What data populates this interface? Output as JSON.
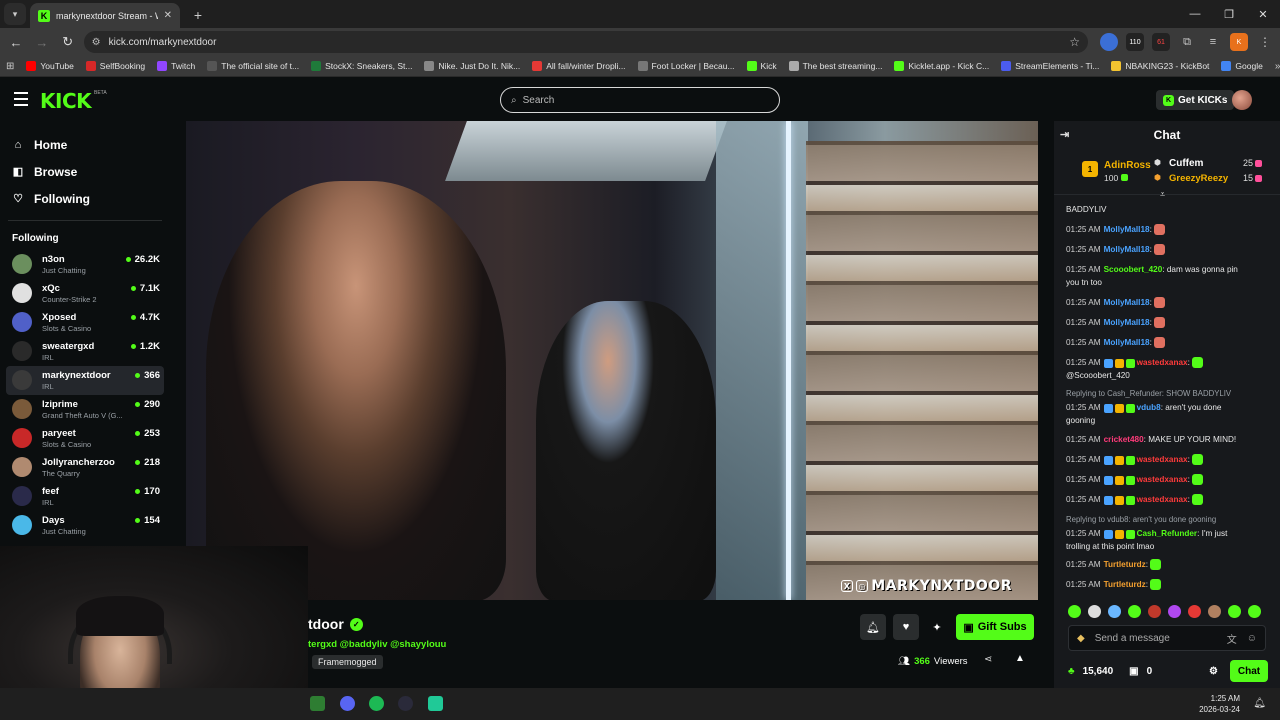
{
  "browser": {
    "tab_title": "markynextdoor Stream - W",
    "url": "kick.com/markynextdoor",
    "extensions": [
      "110",
      "61"
    ],
    "profile_initial": "K",
    "bookmarks": [
      {
        "label": "YouTube",
        "color": "#ff0000"
      },
      {
        "label": "SelfBooking",
        "color": "#d62828"
      },
      {
        "label": "Twitch",
        "color": "#9146ff"
      },
      {
        "label": "The official site of t...",
        "color": "#555555"
      },
      {
        "label": "StockX: Sneakers, St...",
        "color": "#1f7a3a"
      },
      {
        "label": "Nike. Just Do It. Nik...",
        "color": "#888888"
      },
      {
        "label": "All fall/winter Dropli...",
        "color": "#e53935"
      },
      {
        "label": "Foot Locker | Becau...",
        "color": "#777777"
      },
      {
        "label": "Kick",
        "color": "#53fc18"
      },
      {
        "label": "The best streaming...",
        "color": "#aaaaaa"
      },
      {
        "label": "Kicklet.app - Kick C...",
        "color": "#53fc18"
      },
      {
        "label": "StreamElements - Ti...",
        "color": "#4b5cf0"
      },
      {
        "label": "NBAKING23 - KickBot",
        "color": "#f4c430"
      },
      {
        "label": "Google",
        "color": "#4285f4"
      }
    ]
  },
  "header": {
    "logo": "KICK",
    "beta": "BETA",
    "search_placeholder": "Search",
    "get_kicks": "Get KICKs"
  },
  "sidebar": {
    "nav": [
      {
        "label": "Home",
        "icon": "home-icon",
        "glyph": "⌂"
      },
      {
        "label": "Browse",
        "icon": "browse-icon",
        "glyph": "◧"
      },
      {
        "label": "Following",
        "icon": "heart-icon",
        "glyph": "♡"
      }
    ],
    "following_title": "Following",
    "channels": [
      {
        "name": "n3on",
        "category": "Just Chatting",
        "viewers": "26.2K",
        "color": "#6b8f5e"
      },
      {
        "name": "xQc",
        "category": "Counter-Strike 2",
        "viewers": "7.1K",
        "color": "#e0e0e0"
      },
      {
        "name": "Xposed",
        "category": "Slots & Casino",
        "viewers": "4.7K",
        "color": "#5060c8"
      },
      {
        "name": "sweatergxd",
        "category": "IRL",
        "viewers": "1.2K",
        "color": "#2a2a2a"
      },
      {
        "name": "markynextdoor",
        "category": "IRL",
        "viewers": "366",
        "color": "#3a3a3a"
      },
      {
        "name": "lziprime",
        "category": "Grand Theft Auto V (G...",
        "viewers": "290",
        "color": "#7a5a3a"
      },
      {
        "name": "paryeet",
        "category": "Slots & Casino",
        "viewers": "253",
        "color": "#c82828"
      },
      {
        "name": "Jollyrancherzoo",
        "category": "The Quarry",
        "viewers": "218",
        "color": "#b08a70"
      },
      {
        "name": "feef",
        "category": "IRL",
        "viewers": "170",
        "color": "#2a2a4a"
      },
      {
        "name": "Days",
        "category": "Just Chatting",
        "viewers": "154",
        "color": "#4ab8e8"
      }
    ]
  },
  "video": {
    "watermark": "MARKYNXTDOOR"
  },
  "stream": {
    "name_visible": "tdoor",
    "title_visible": "tergxd @baddyliv @shayylouu",
    "category": "Framemogged",
    "viewers": "366",
    "viewers_label": "Viewers",
    "gift_subs": "Gift Subs"
  },
  "chat": {
    "title": "Chat",
    "leaderboard": {
      "rank": "1",
      "first_name": "AdinRoss",
      "first_value": "100",
      "second_name": "Cuffem",
      "second_value": "25",
      "third_name": "GreezyReezy",
      "third_value": "15"
    },
    "messages": [
      {
        "time": "",
        "user": "",
        "text": "BADDYLIV",
        "user_color": "#e8e8e8"
      },
      {
        "time": "01:25 AM",
        "user": "MollyMall18",
        "text": "",
        "user_color": "#4aa3ff"
      },
      {
        "time": "01:25 AM",
        "user": "MollyMall18",
        "text": "",
        "user_color": "#4aa3ff"
      },
      {
        "time": "01:25 AM",
        "user": "Scooobert_420",
        "text": "dam was gonna pin",
        "text2": "you tn too",
        "user_color": "#53fc18"
      },
      {
        "time": "01:25 AM",
        "user": "MollyMall18",
        "text": "",
        "user_color": "#4aa3ff"
      },
      {
        "time": "01:25 AM",
        "user": "MollyMall18",
        "text": "",
        "user_color": "#4aa3ff"
      },
      {
        "time": "01:25 AM",
        "user": "MollyMall18",
        "text": "",
        "user_color": "#4aa3ff"
      },
      {
        "time": "01:25 AM",
        "user": "wastedxanax",
        "text": "",
        "text2": "@Scooobert_420",
        "user_color": "#ff3b3b"
      },
      {
        "reply": "Replying to Cash_Refunder: SHOW BADDYLIV"
      },
      {
        "time": "01:25 AM",
        "user": "vdub8",
        "text": "aren't you done",
        "text2": "gooning",
        "user_color": "#4aa3ff"
      },
      {
        "time": "01:25 AM",
        "user": "cricket480",
        "text": "MAKE UP YOUR MIND!",
        "user_color": "#ff3b7a"
      },
      {
        "time": "01:25 AM",
        "user": "wastedxanax",
        "text": "",
        "user_color": "#ff3b3b"
      },
      {
        "time": "01:25 AM",
        "user": "wastedxanax",
        "text": "",
        "user_color": "#ff3b3b"
      },
      {
        "time": "01:25 AM",
        "user": "wastedxanax",
        "text": "",
        "user_color": "#ff3b3b"
      },
      {
        "reply": "Replying to vdub8: aren't you done gooning"
      },
      {
        "time": "01:25 AM",
        "user": "Cash_Refunder",
        "text": "I'm just",
        "text2": "trolling at this point lmao",
        "user_color": "#53fc18"
      },
      {
        "time": "01:25 AM",
        "user": "Turtleturdz",
        "text": "",
        "user_color": "#f4a030"
      },
      {
        "time": "01:25 AM",
        "user": "Turtleturdz",
        "text": "",
        "user_color": "#f4a030"
      }
    ],
    "send_placeholder": "Send a message",
    "points": "15,640",
    "subs": "0",
    "chat_button": "Chat"
  },
  "taskbar": {
    "time": "1:25 AM",
    "date": "2026-03-24"
  },
  "colors": {
    "kick_green": "#53fc18",
    "background": "#0b0e0f",
    "chat_bg": "#17191c"
  }
}
